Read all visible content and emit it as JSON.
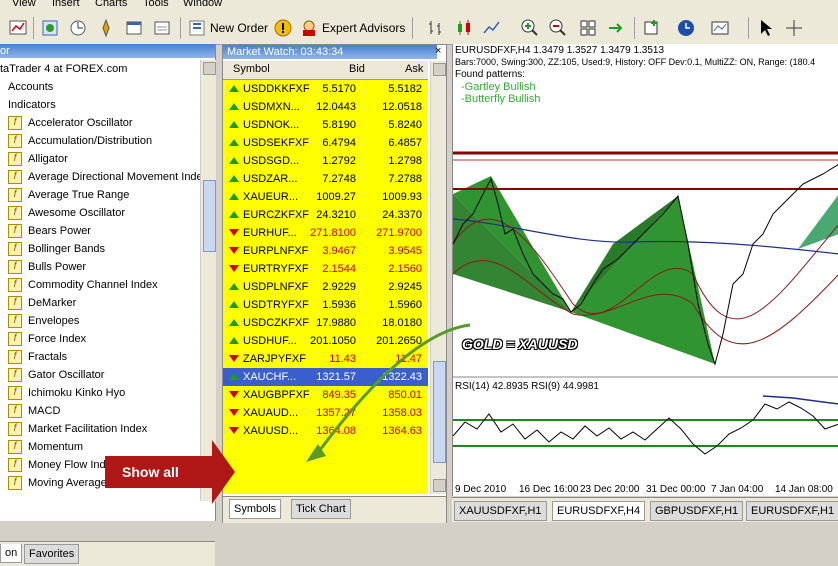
{
  "menubar": {
    "items": [
      "View",
      "Insert",
      "Charts",
      "Tools",
      "Window"
    ]
  },
  "toolbar": {
    "new_order": "New Order",
    "expert_advisors": "Expert Advisors"
  },
  "navigator": {
    "title": "or",
    "root": "taTrader 4 at FOREX.com",
    "accounts": "Accounts",
    "indicators": "Indicators",
    "items": [
      "Accelerator Oscillator",
      "Accumulation/Distribution",
      "Alligator",
      "Average Directional Movement Inde",
      "Average True Range",
      "Awesome Oscillator",
      "Bears Power",
      "Bollinger Bands",
      "Bulls Power",
      "Commodity Channel Index",
      "DeMarker",
      "Envelopes",
      "Force Index",
      "Fractals",
      "Gator Oscillator",
      "Ichimoku Kinko Hyo",
      "MACD",
      "Market Facilitation Index",
      "Momentum",
      "Money Flow Index",
      "Moving Average"
    ],
    "tabs": [
      "on",
      "Favorites"
    ]
  },
  "market_watch": {
    "title": "Market Watch: 03:43:34",
    "columns": {
      "symbol": "Symbol",
      "bid": "Bid",
      "ask": "Ask"
    },
    "rows": [
      {
        "symbol": "USDDKKFXF",
        "bid": "5.5170",
        "ask": "5.5182",
        "dir": "up"
      },
      {
        "symbol": "USDMXN...",
        "bid": "12.0443",
        "ask": "12.0518",
        "dir": "up"
      },
      {
        "symbol": "USDNOK...",
        "bid": "5.8190",
        "ask": "5.8240",
        "dir": "up"
      },
      {
        "symbol": "USDSEKFXF",
        "bid": "6.4794",
        "ask": "6.4857",
        "dir": "up"
      },
      {
        "symbol": "USDSGD...",
        "bid": "1.2792",
        "ask": "1.2798",
        "dir": "up"
      },
      {
        "symbol": "USDZAR...",
        "bid": "7.2748",
        "ask": "7.2788",
        "dir": "up"
      },
      {
        "symbol": "XAUEUR...",
        "bid": "1009.27",
        "ask": "1009.93",
        "dir": "up"
      },
      {
        "symbol": "EURCZKFXF",
        "bid": "24.3210",
        "ask": "24.3370",
        "dir": "up"
      },
      {
        "symbol": "EURHUF...",
        "bid": "271.8100",
        "ask": "271.9700",
        "dir": "down"
      },
      {
        "symbol": "EURPLNFXF",
        "bid": "3.9467",
        "ask": "3.9545",
        "dir": "down"
      },
      {
        "symbol": "EURTRYFXF",
        "bid": "2.1544",
        "ask": "2.1560",
        "dir": "down"
      },
      {
        "symbol": "USDPLNFXF",
        "bid": "2.9229",
        "ask": "2.9245",
        "dir": "up"
      },
      {
        "symbol": "USDTRYFXF",
        "bid": "1.5936",
        "ask": "1.5960",
        "dir": "up"
      },
      {
        "symbol": "USDCZKFXF",
        "bid": "17.9880",
        "ask": "18.0180",
        "dir": "up"
      },
      {
        "symbol": "USDHUF...",
        "bid": "201.1050",
        "ask": "201.2650",
        "dir": "up"
      },
      {
        "symbol": "ZARJPYFXF",
        "bid": "11.43",
        "ask": "11.47",
        "dir": "down"
      },
      {
        "symbol": "XAUCHF...",
        "bid": "1321.57",
        "ask": "1322.43",
        "dir": "up",
        "selected": true
      },
      {
        "symbol": "XAUGBPFXF",
        "bid": "849.35",
        "ask": "850.01",
        "dir": "down"
      },
      {
        "symbol": "XAUAUD...",
        "bid": "1357.27",
        "ask": "1358.03",
        "dir": "down"
      },
      {
        "symbol": "XAUUSD...",
        "bid": "1364.08",
        "ask": "1364.63",
        "dir": "down"
      }
    ],
    "tabs": [
      "Symbols",
      "Tick Chart"
    ]
  },
  "chart": {
    "info_line": "EURUSDFXF,H4  1.3479 1.3527 1.3479 1.3513",
    "info_line2": "Bars:7000, Swing:300, ZZ:105, Used:9, History: OFF Dev:0.1, MultiZZ: ON, Range: (180.4",
    "patterns_title": "Found patterns:",
    "patterns": [
      "-Gartley Bullish",
      "-Butterfly Bullish"
    ],
    "rsi_label": "RSI(14) 42.8935  RSI(9) 44.9981",
    "time_labels": [
      "9 Dec 2010",
      "16 Dec 16:00",
      "23 Dec 20:00",
      "31 Dec 00:00",
      "7 Jan 04:00",
      "14 Jan 08:00"
    ],
    "tabs": [
      "XAUUSDFXF,H1",
      "EURUSDFXF,H4",
      "GBPUSDFXF,H1",
      "EURUSDFXF,H1"
    ]
  },
  "annotations": {
    "gold_label": "GOLD = XAUUSD",
    "show_all": "Show all"
  },
  "colors": {
    "mw_background": "#ffff00",
    "mw_selected": "#3a5fcd",
    "bid_down": "#d20000",
    "pattern_green": "#1a8a1a",
    "resistance": "#8b0000",
    "callout_red": "#b01818"
  }
}
